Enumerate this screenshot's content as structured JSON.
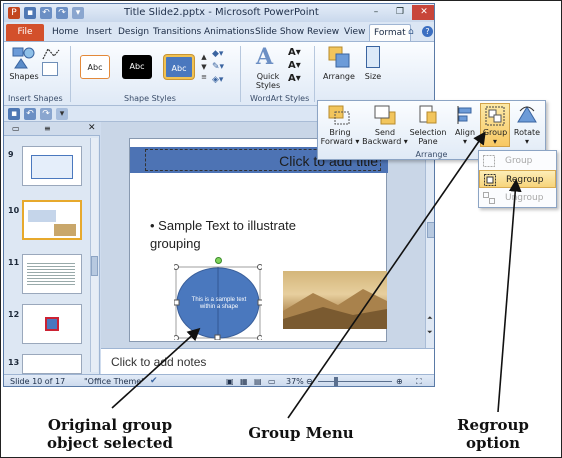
{
  "window": {
    "title": "Title Slide2.pptx - Microsoft PowerPoint",
    "controls": {
      "minimize": "–",
      "restore": "❐",
      "close": "✕"
    }
  },
  "tabs": [
    "File",
    "Home",
    "Insert",
    "Design",
    "Transitions",
    "Animations",
    "Slide Show",
    "Review",
    "View",
    "Format"
  ],
  "ribbon": {
    "groups": {
      "insert_shapes": "Insert Shapes",
      "shape_styles": "Shape Styles",
      "wordart_styles": "WordArt Styles"
    },
    "shapes_label": "Shapes",
    "style_samples": [
      "Abc",
      "Abc",
      "Abc"
    ],
    "quick_styles_label": "Quick Styles",
    "arrange_label": "Arrange",
    "size_label": "Size"
  },
  "arrange_popup": {
    "group_label": "Arrange",
    "buttons": [
      {
        "label_line1": "Bring",
        "label_line2": "Forward ▾"
      },
      {
        "label_line1": "Send",
        "label_line2": "Backward ▾"
      },
      {
        "label_line1": "Selection",
        "label_line2": "Pane"
      },
      {
        "label_line1": "Align",
        "label_line2": "▾"
      },
      {
        "label_line1": "Group",
        "label_line2": "▾"
      },
      {
        "label_line1": "Rotate",
        "label_line2": "▾"
      }
    ]
  },
  "group_menu": {
    "items": [
      {
        "label": "Group",
        "enabled": false
      },
      {
        "label": "Regroup",
        "enabled": true
      },
      {
        "label": "Ungroup",
        "enabled": false
      }
    ]
  },
  "slides_panel": {
    "slide_numbers": [
      "9",
      "10",
      "11",
      "12",
      "13"
    ],
    "selected": "10"
  },
  "slide": {
    "title_placeholder": "Click to add title",
    "bullet": "• Sample Text to illustrate grouping",
    "shape_text": "This is a sample text within a shape"
  },
  "notes_placeholder": "Click to add notes",
  "status": {
    "slide_info": "Slide 10 of 17",
    "theme": "\"Office Theme\"",
    "zoom": "37%"
  },
  "annotations": {
    "original": "Original group object selected",
    "group_menu": "Group Menu",
    "regroup": "Regroup option"
  },
  "colors": {
    "file_tab": "#d3502b",
    "title_band": "#4d73b4",
    "shape_fill": "#4a78be",
    "highlight": "#f8c863"
  }
}
